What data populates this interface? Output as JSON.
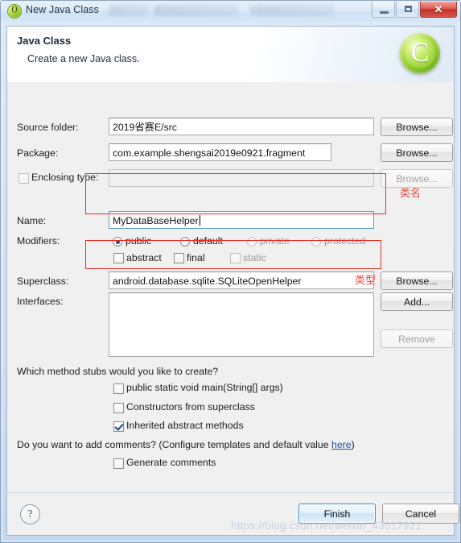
{
  "window": {
    "title": "New Java Class",
    "icon": "java-class-icon",
    "buttons": {
      "minimize": "minimize-icon",
      "maximize": "maximize-icon",
      "close": "✕"
    }
  },
  "header": {
    "title": "Java Class",
    "subtitle": "Create a new Java class.",
    "icon": "C"
  },
  "form": {
    "source_folder": {
      "label": "Source folder:",
      "value": "2019省赛E/src",
      "browse": "Browse..."
    },
    "package": {
      "label": "Package:",
      "value": "com.example.shengsai2019e0921.fragment",
      "browse": "Browse..."
    },
    "enclosing_type": {
      "label": "Enclosing type:",
      "value": "",
      "checked": false,
      "browse": "Browse..."
    },
    "name": {
      "label": "Name:",
      "value": "MyDataBaseHelper"
    },
    "modifiers": {
      "label": "Modifiers:",
      "radios": [
        {
          "label": "public",
          "selected": true,
          "enabled": true
        },
        {
          "label": "default",
          "selected": false,
          "enabled": true
        },
        {
          "label": "private",
          "selected": false,
          "enabled": false
        },
        {
          "label": "protected",
          "selected": false,
          "enabled": false
        }
      ],
      "checkboxes": [
        {
          "label": "abstract",
          "checked": false,
          "enabled": true
        },
        {
          "label": "final",
          "checked": false,
          "enabled": true
        },
        {
          "label": "static",
          "checked": false,
          "enabled": false
        }
      ]
    },
    "superclass": {
      "label": "Superclass:",
      "value": "android.database.sqlite.SQLiteOpenHelper",
      "browse": "Browse..."
    },
    "interfaces": {
      "label": "Interfaces:",
      "items": [],
      "add": "Add...",
      "remove": "Remove"
    }
  },
  "stubs": {
    "question": "Which method stubs would you like to create?",
    "options": [
      {
        "label": "public static void main(String[] args)",
        "checked": false
      },
      {
        "label": "Constructors from superclass",
        "checked": false
      },
      {
        "label": "Inherited abstract methods",
        "checked": true
      }
    ]
  },
  "comments": {
    "question_prefix": "Do you want to add comments? (Configure templates and default value ",
    "link": "here",
    "question_suffix": ")",
    "generate": {
      "label": "Generate comments",
      "checked": false
    }
  },
  "footer": {
    "help": "?",
    "finish": "Finish",
    "cancel": "Cancel"
  },
  "annotations": {
    "class_name": "类名",
    "type": "类型",
    "color": "#ee2b24"
  },
  "watermark": "https://blog.csdn.net/weixin_43017921"
}
